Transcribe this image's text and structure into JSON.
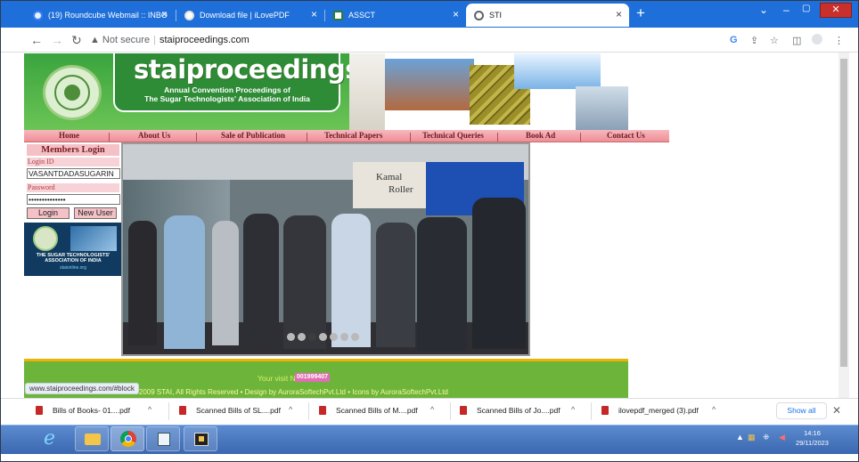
{
  "tabs": [
    {
      "title": "(19) Roundcube Webmail :: INBO",
      "icon": "roundcube-icon",
      "color": "#3b82f6"
    },
    {
      "title": "Download file | iLovePDF",
      "icon": "chrome-icon",
      "color": "#ffffff"
    },
    {
      "title": "ASSCT",
      "icon": "assct-icon",
      "color": "#2e7d32"
    },
    {
      "title": "STI",
      "icon": "globe-icon",
      "color": "#5f6368"
    }
  ],
  "address": {
    "security": "Not secure",
    "url": "staiproceedings.com"
  },
  "site": {
    "brand": "staiproceedings.com",
    "tagline_line1": "Annual Convention Proceedings of",
    "tagline_line2": "The Sugar Technologists' Association of India",
    "nav": [
      "Home",
      "About Us",
      "Sale of Publication",
      "Technical Papers",
      "Technical Queries",
      "Book Ad",
      "Contact Us"
    ],
    "login": {
      "title": "Members Login",
      "id_label": "Login ID",
      "id_value": "VASANTDADASUGARIN",
      "pw_label": "Password",
      "pw_value": "••••••••••••••",
      "login_btn": "Login",
      "new_user_btn": "New User"
    },
    "stai_logo_text": "THE SUGAR TECHNOLOGISTS' ASSOCIATION OF INDIA",
    "stai_logo_url": "staionline.org",
    "slide_sign_line1": "Kamal",
    "slide_sign_line2": "Roller",
    "visit_label": "Your visit Number:",
    "visit_number": "001999407",
    "copyright": "©2009 STAI, All Rights Reserved   •   Design by AuroraSoftechPvt.Ltd   •   Icons by AuroraSoftechPvt.Ltd",
    "hover_url": "www.staiproceedings.com/#block"
  },
  "downloads": [
    {
      "name": "Bills of Books- 01....pdf"
    },
    {
      "name": "Scanned Bills of SL....pdf"
    },
    {
      "name": "Scanned Bills of M....pdf"
    },
    {
      "name": "Scanned Bills of Jo....pdf"
    },
    {
      "name": "ilovepdf_merged (3).pdf"
    }
  ],
  "downloads_show_all": "Show all",
  "taskbar": {
    "time": "14:16",
    "date": "29/11/2023"
  }
}
